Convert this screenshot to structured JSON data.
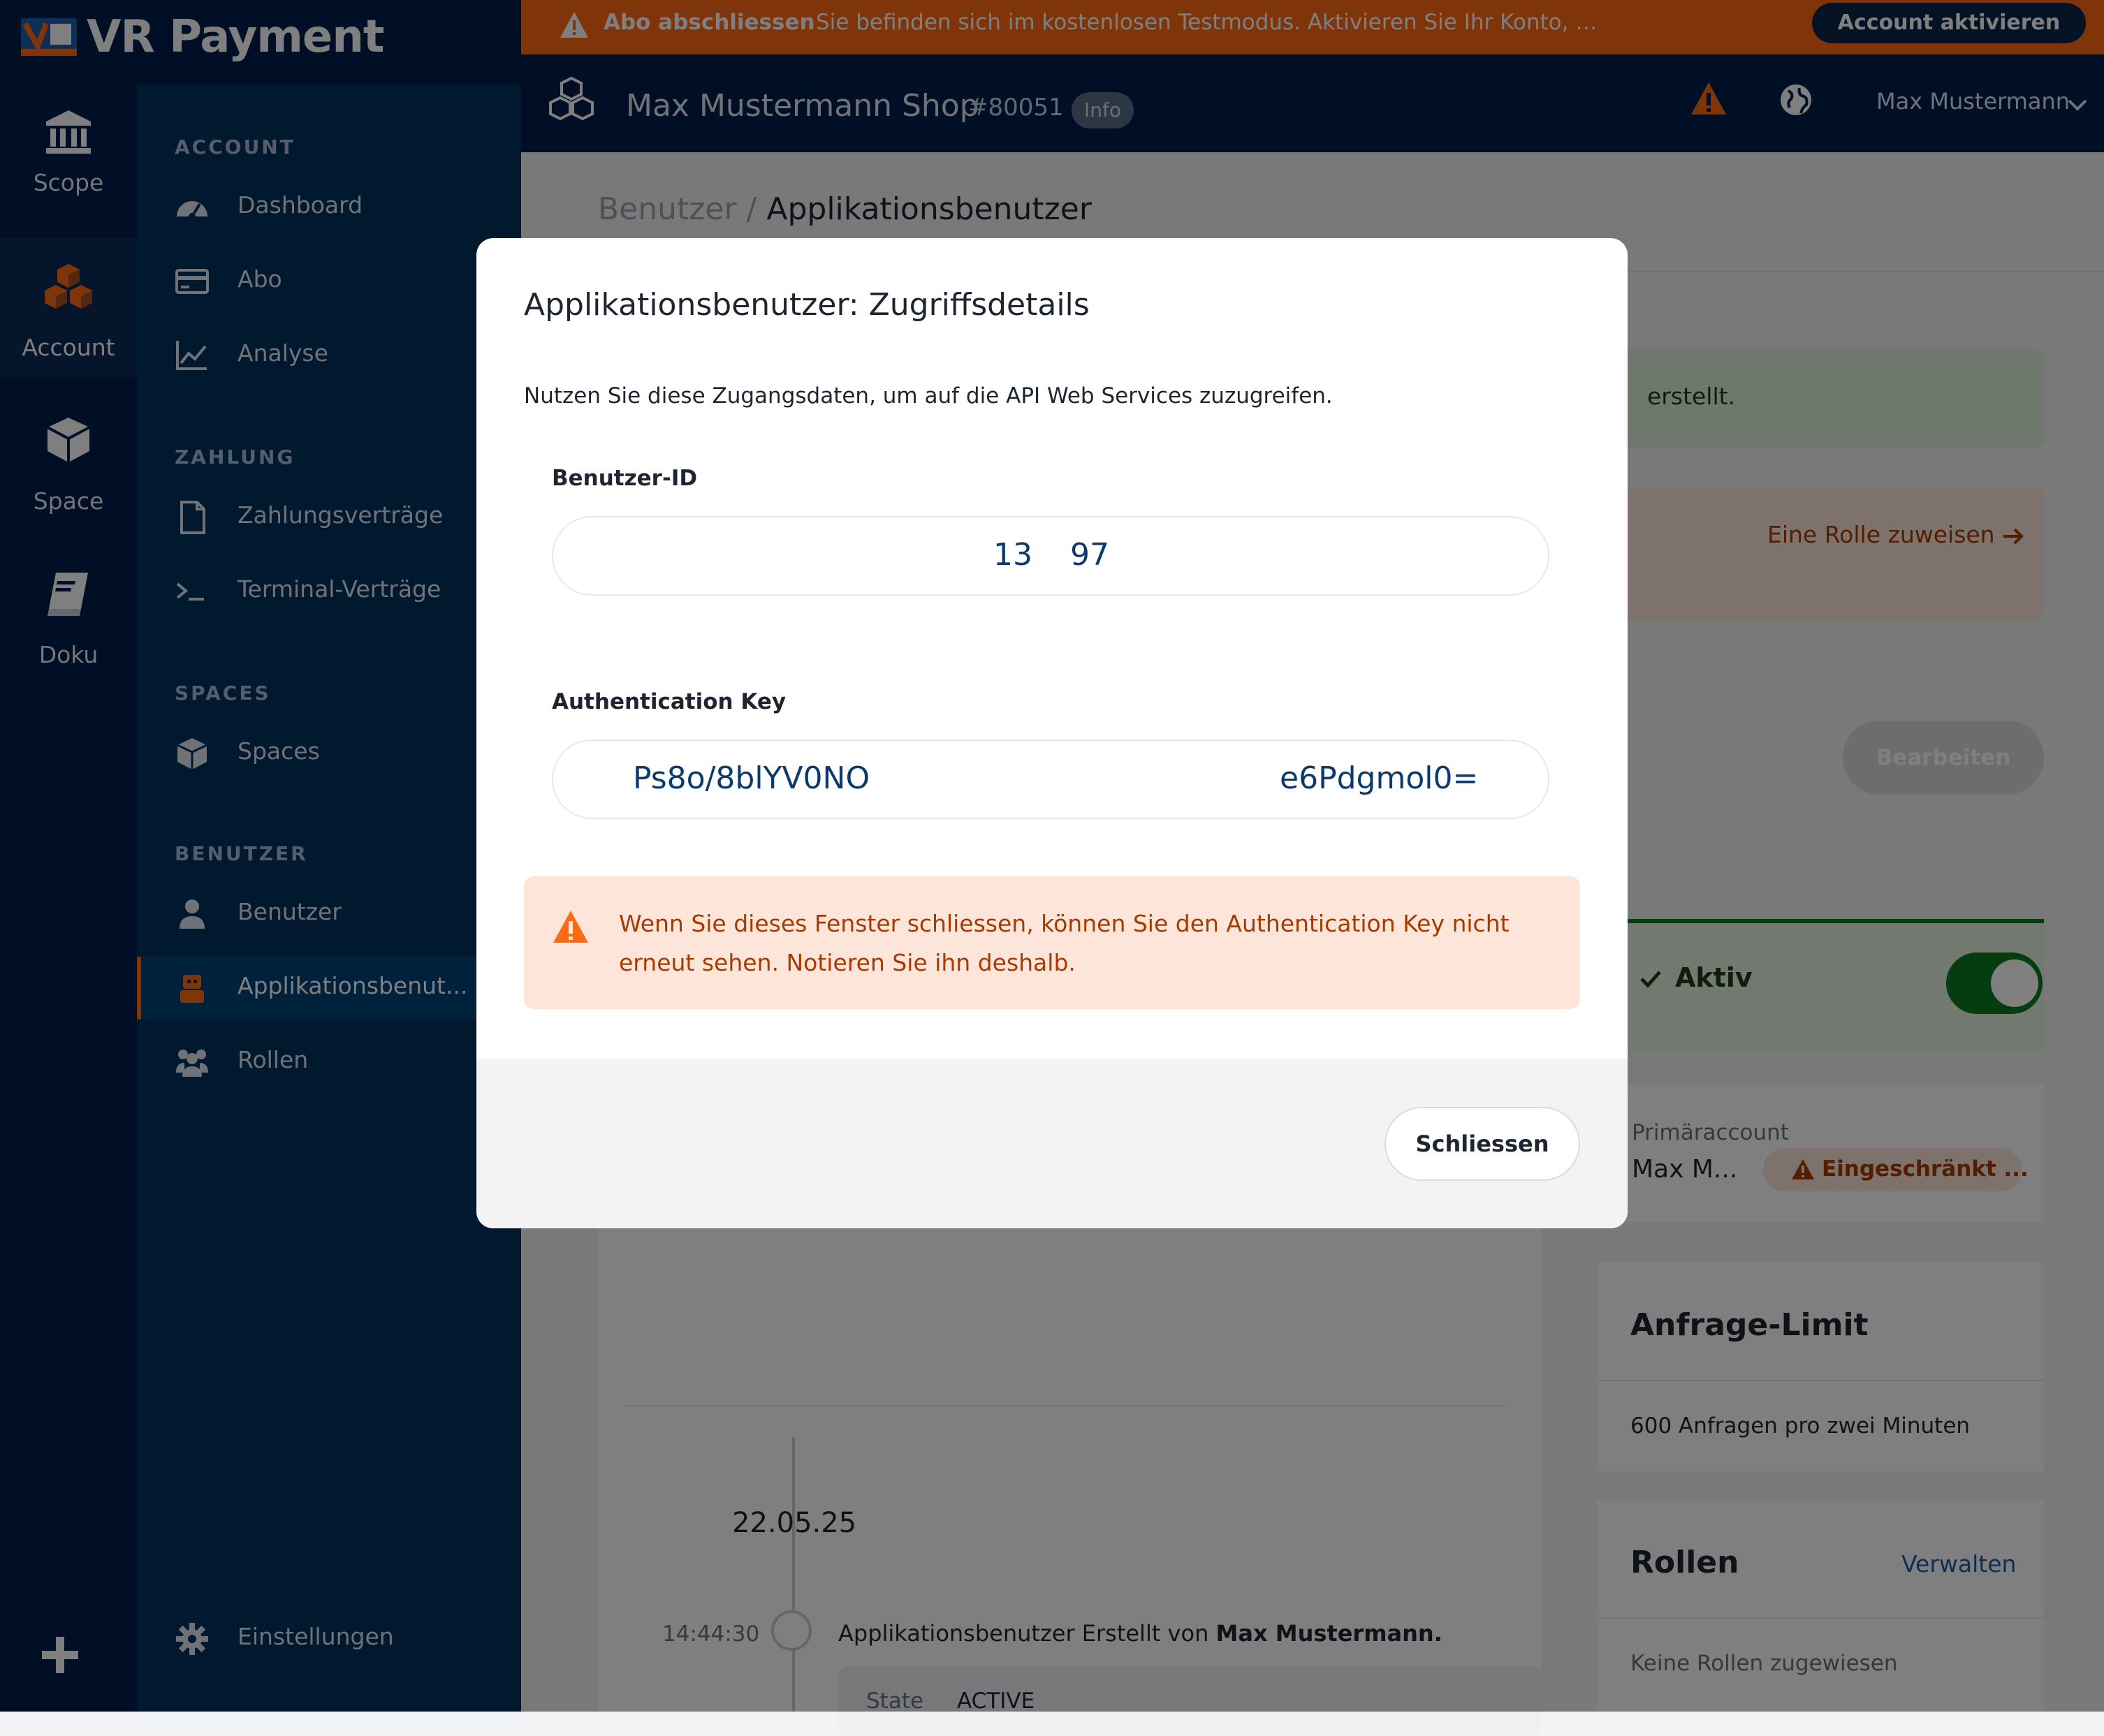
{
  "brand": {
    "name": "VR Payment"
  },
  "rail": {
    "items": [
      {
        "label": "Scope",
        "icon": "bank-icon"
      },
      {
        "label": "Account",
        "icon": "cubes-icon"
      },
      {
        "label": "Space",
        "icon": "cube-icon"
      },
      {
        "label": "Doku",
        "icon": "book-icon"
      }
    ],
    "add_icon": "plus-icon"
  },
  "nav": {
    "sections": {
      "account": "ACCOUNT",
      "zahlung": "ZAHLUNG",
      "spaces": "SPACES",
      "benutzer": "BENUTZER"
    },
    "items": {
      "dashboard": "Dashboard",
      "abo": "Abo",
      "analyse": "Analyse",
      "zahlungsvertraege": "Zahlungsverträge",
      "terminal": "Terminal-Verträge",
      "spaces": "Spaces",
      "benutzer": "Benutzer",
      "appbenutzer": "Applikationsbenut...",
      "rollen": "Rollen",
      "einstellungen": "Einstellungen"
    }
  },
  "alertbar": {
    "title": "Abo abschliessen",
    "message": "Sie befinden sich im kostenlosen Testmodus. Aktivieren Sie Ihr Konto, sobald Sie Ihr Zahl...",
    "button": "Account aktivieren"
  },
  "shopbar": {
    "shop_name": "Max Mustermann Shop",
    "shop_id": "#80051",
    "info_badge": "Info",
    "user_name": "Max Mustermann"
  },
  "page": {
    "breadcrumb_parent": "Benutzer",
    "breadcrumb_sep": "/",
    "breadcrumb_current": "Applikationsbenutzer",
    "success_partial": "erstellt.",
    "assign_role": "Eine Rolle zuweisen",
    "edit_button": "Bearbeiten",
    "status_label": "Aktiv",
    "status_on": true,
    "primary_label": "Primäraccount",
    "primary_value": "Max M...",
    "primary_badge": "Eingeschränkt ...",
    "limit_title": "Anfrage-Limit",
    "limit_value": "600 Anfragen pro zwei Minuten",
    "roles_title": "Rollen",
    "roles_manage": "Verwalten",
    "roles_empty": "Keine Rollen zugewiesen",
    "timeline_date": "22.05.25",
    "timeline_time": "14:44:30",
    "timeline_text": "Applikationsbenutzer Erstellt von",
    "timeline_author": "Max Mustermann.",
    "state_label": "State",
    "state_value": "ACTIVE"
  },
  "modal": {
    "title": "Applikationsbenutzer: Zugriffsdetails",
    "description": "Nutzen Sie diese Zugangsdaten, um auf die API Web Services zuzugreifen.",
    "user_id_label": "Benutzer-ID",
    "user_id_part1": "13",
    "user_id_part2": "97",
    "auth_key_label": "Authentication Key",
    "auth_key_part1": "Ps8o/8blYV0NO",
    "auth_key_part2": "e6Pdgmol0=",
    "warning": "Wenn Sie dieses Fenster schliessen, können Sie den Authentication Key nicht erneut sehen. Notieren Sie ihn deshalb.",
    "close_button": "Schliessen"
  },
  "colors": {
    "navy": "#001f4a",
    "nav_panel": "#00335f",
    "orange": "#ff6b12",
    "green": "#0a7a20",
    "link_blue": "#1a5fa8"
  }
}
